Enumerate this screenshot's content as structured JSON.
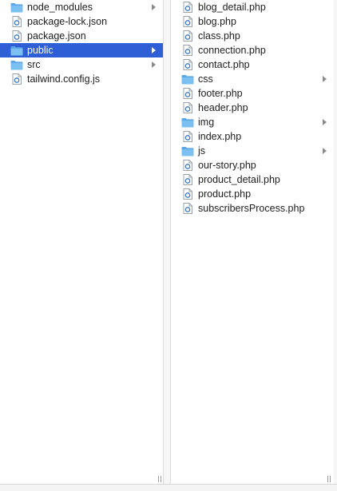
{
  "column1": {
    "items": [
      {
        "label": "node_modules",
        "icon": "folder-icon",
        "has_children": true,
        "selected": false
      },
      {
        "label": "package-lock.json",
        "icon": "file-icon",
        "has_children": false,
        "selected": false
      },
      {
        "label": "package.json",
        "icon": "file-icon",
        "has_children": false,
        "selected": false
      },
      {
        "label": "public",
        "icon": "folder-icon",
        "has_children": true,
        "selected": true
      },
      {
        "label": "src",
        "icon": "folder-icon",
        "has_children": true,
        "selected": false
      },
      {
        "label": "tailwind.config.js",
        "icon": "file-icon",
        "has_children": false,
        "selected": false
      }
    ]
  },
  "column2": {
    "items": [
      {
        "label": "blog_detail.php",
        "icon": "file-icon",
        "has_children": false
      },
      {
        "label": "blog.php",
        "icon": "file-icon",
        "has_children": false
      },
      {
        "label": "class.php",
        "icon": "file-icon",
        "has_children": false
      },
      {
        "label": "connection.php",
        "icon": "file-icon",
        "has_children": false
      },
      {
        "label": "contact.php",
        "icon": "file-icon",
        "has_children": false
      },
      {
        "label": "css",
        "icon": "folder-icon",
        "has_children": true
      },
      {
        "label": "footer.php",
        "icon": "file-icon",
        "has_children": false
      },
      {
        "label": "header.php",
        "icon": "file-icon",
        "has_children": false
      },
      {
        "label": "img",
        "icon": "folder-icon",
        "has_children": true
      },
      {
        "label": "index.php",
        "icon": "file-icon",
        "has_children": false
      },
      {
        "label": "js",
        "icon": "folder-icon",
        "has_children": true
      },
      {
        "label": "our-story.php",
        "icon": "file-icon",
        "has_children": false
      },
      {
        "label": "product_detail.php",
        "icon": "file-icon",
        "has_children": false
      },
      {
        "label": "product.php",
        "icon": "file-icon",
        "has_children": false
      },
      {
        "label": "subscribersProcess.php",
        "icon": "file-icon",
        "has_children": false
      }
    ]
  },
  "colors": {
    "selection": "#2e5fd6",
    "folder": "#7cc0f2",
    "folder_tab": "#5aa8e6"
  }
}
